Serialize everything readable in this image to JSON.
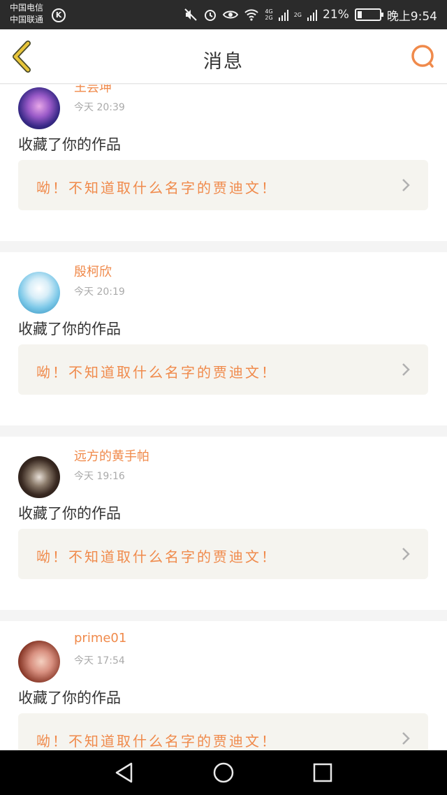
{
  "status_bar": {
    "carrier_1": "中国电信",
    "carrier_2": "中国联通",
    "network_top": "4G",
    "network_bottom": "2G",
    "network_2": "2G",
    "battery_percent": "21%",
    "battery_level": 0.21,
    "time": "晚上9:54",
    "icons": [
      "mute-icon",
      "alarm-icon",
      "eye-icon",
      "wifi-icon",
      "signal-icon",
      "battery-icon"
    ]
  },
  "header": {
    "title": "消息",
    "back_icon": "chevron-left-icon",
    "search_icon": "search-icon"
  },
  "messages": [
    {
      "username": "王芸坤",
      "time": "今天 20:39",
      "action": "收藏了你的作品",
      "work_title": "呦！不知道取什么名字的贾迪文！"
    },
    {
      "username": "殷柯欣",
      "time": "今天 20:19",
      "action": "收藏了你的作品",
      "work_title": "呦！不知道取什么名字的贾迪文！"
    },
    {
      "username": "远方的黄手帕",
      "time": "今天 19:16",
      "action": "收藏了你的作品",
      "work_title": "呦！不知道取什么名字的贾迪文！"
    },
    {
      "username": "prime01",
      "time": "今天 17:54",
      "action": "收藏了你的作品",
      "work_title": "呦！不知道取什么名字的贾迪文！"
    }
  ],
  "colors": {
    "accent": "#f08a4b",
    "back_icon": "#e8c53a",
    "status_bar_bg": "#2b2b2b",
    "nav_bar_bg": "#000000"
  }
}
